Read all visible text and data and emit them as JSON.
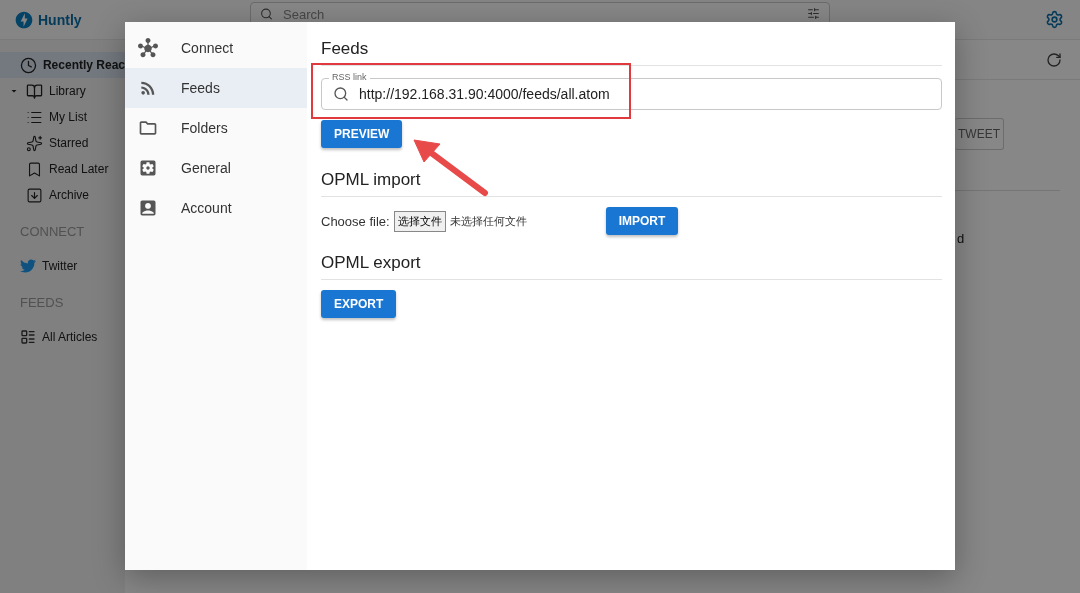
{
  "app": {
    "brand": "Huntly",
    "search": {
      "placeholder": "Search"
    },
    "sidebar": {
      "items": [
        {
          "label": "Recently Reac",
          "selected": true
        },
        {
          "label": "Library",
          "selected": false,
          "expanded": true,
          "children": [
            {
              "label": "My List",
              "selected": false
            },
            {
              "label": "Starred",
              "selected": false
            },
            {
              "label": "Read Later",
              "selected": false
            },
            {
              "label": "Archive",
              "selected": false
            }
          ]
        }
      ],
      "sections": [
        {
          "title": "CONNECT",
          "items": [
            {
              "label": "Twitter",
              "selected": false
            }
          ]
        },
        {
          "title": "FEEDS",
          "items": [
            {
              "label": "All Articles",
              "selected": false
            }
          ]
        }
      ]
    },
    "content": {
      "button": "TWEET",
      "text_fragment": "d"
    }
  },
  "settings_dialog": {
    "nav": [
      {
        "label": "Connect",
        "selected": false
      },
      {
        "label": "Feeds",
        "selected": true
      },
      {
        "label": "Folders",
        "selected": false
      },
      {
        "label": "General",
        "selected": false
      },
      {
        "label": "Account",
        "selected": false
      }
    ],
    "title": "Feeds",
    "rss_field": {
      "label": "RSS link",
      "value": "http://192.168.31.90:4000/feeds/all.atom"
    },
    "preview_button": "PREVIEW",
    "sections": [
      {
        "kind": "import",
        "title": "OPML import",
        "file_label": "Choose file:",
        "file_button": "选择文件",
        "file_status": "未选择任何文件",
        "button": "IMPORT"
      },
      {
        "kind": "export",
        "title": "OPML export",
        "button": "EXPORT"
      }
    ]
  }
}
